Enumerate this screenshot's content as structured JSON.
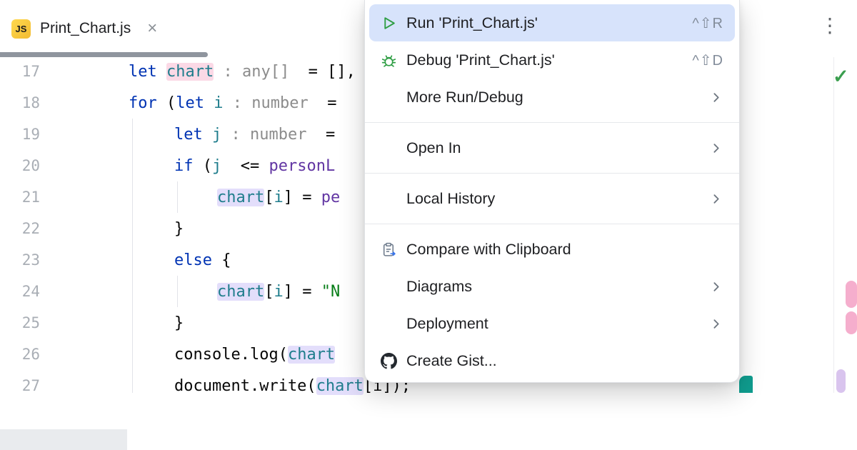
{
  "tab": {
    "file_icon_label": "JS",
    "title": "Print_Chart.js",
    "close_glyph": "×",
    "more_glyph": "⋮"
  },
  "editor": {
    "inspection_check_glyph": "✓",
    "lines": [
      {
        "num": 17,
        "indent": 0,
        "tokens": [
          {
            "t": "let ",
            "c": "kw"
          },
          {
            "t": "chart",
            "c": "var",
            "hl": "pink"
          },
          {
            "t": " ",
            "c": "plain"
          },
          {
            "t": ": any[]",
            "c": "type"
          },
          {
            "t": "  = ",
            "c": "plain"
          },
          {
            "t": "[],",
            "c": "plain"
          }
        ]
      },
      {
        "num": 18,
        "indent": 0,
        "tokens": [
          {
            "t": "for",
            "c": "kw"
          },
          {
            "t": " (",
            "c": "plain"
          },
          {
            "t": "let",
            "c": "kw"
          },
          {
            "t": " ",
            "c": "plain"
          },
          {
            "t": "i",
            "c": "var"
          },
          {
            "t": " ",
            "c": "plain"
          },
          {
            "t": ": number",
            "c": "type"
          },
          {
            "t": "  =",
            "c": "plain"
          }
        ]
      },
      {
        "num": 19,
        "indent": 1,
        "tokens": [
          {
            "t": "let",
            "c": "kw"
          },
          {
            "t": " ",
            "c": "plain"
          },
          {
            "t": "j",
            "c": "var"
          },
          {
            "t": " ",
            "c": "plain"
          },
          {
            "t": ": number",
            "c": "type"
          },
          {
            "t": "  = ",
            "c": "plain"
          }
        ]
      },
      {
        "num": 20,
        "indent": 1,
        "tokens": [
          {
            "t": "if",
            "c": "kw"
          },
          {
            "t": " (",
            "c": "plain"
          },
          {
            "t": "j",
            "c": "var"
          },
          {
            "t": "  <= ",
            "c": "plain"
          },
          {
            "t": "personL",
            "c": "field"
          }
        ]
      },
      {
        "num": 21,
        "indent": 2,
        "tokens": [
          {
            "t": "chart",
            "c": "var",
            "hl": "lav"
          },
          {
            "t": "[",
            "c": "plain"
          },
          {
            "t": "i",
            "c": "var"
          },
          {
            "t": "] = ",
            "c": "plain"
          },
          {
            "t": "pe",
            "c": "field"
          }
        ]
      },
      {
        "num": 22,
        "indent": 1,
        "tokens": [
          {
            "t": "}",
            "c": "plain"
          }
        ]
      },
      {
        "num": 23,
        "indent": 1,
        "tokens": [
          {
            "t": "else",
            "c": "kw"
          },
          {
            "t": " {",
            "c": "plain"
          }
        ]
      },
      {
        "num": 24,
        "indent": 2,
        "tokens": [
          {
            "t": "chart",
            "c": "var",
            "hl": "lav"
          },
          {
            "t": "[",
            "c": "plain"
          },
          {
            "t": "i",
            "c": "var"
          },
          {
            "t": "] = ",
            "c": "plain"
          },
          {
            "t": "\"N",
            "c": "str"
          }
        ]
      },
      {
        "num": 25,
        "indent": 1,
        "tokens": [
          {
            "t": "}",
            "c": "plain"
          }
        ]
      },
      {
        "num": 26,
        "indent": 1,
        "tokens": [
          {
            "t": "console.log(",
            "c": "plain"
          },
          {
            "t": "chart",
            "c": "var",
            "hl": "lav"
          }
        ]
      },
      {
        "num": 27,
        "indent": 1,
        "tokens": [
          {
            "t": "document.write(",
            "c": "plain"
          },
          {
            "t": "chart",
            "c": "var",
            "hl": "lav"
          },
          {
            "t": "[i]);",
            "c": "plain"
          }
        ]
      }
    ]
  },
  "menu": {
    "items": [
      {
        "label": "Run 'Print_Chart.js'",
        "icon": "run",
        "shortcut": "^⇧R",
        "selected": true
      },
      {
        "label": "Debug 'Print_Chart.js'",
        "icon": "debug",
        "shortcut": "^⇧D"
      },
      {
        "label": "More Run/Debug",
        "submenu": true
      },
      {
        "type": "separator"
      },
      {
        "label": "Open In",
        "submenu": true
      },
      {
        "type": "separator"
      },
      {
        "label": "Local History",
        "submenu": true
      },
      {
        "type": "separator"
      },
      {
        "label": "Compare with Clipboard",
        "icon": "clipboard"
      },
      {
        "label": "Diagrams",
        "submenu": true
      },
      {
        "label": "Deployment",
        "submenu": true
      },
      {
        "label": "Create Gist...",
        "icon": "github"
      }
    ]
  },
  "colors": {
    "selection": "#d7e3fb",
    "run_green": "#2f9e44",
    "keyword": "#0033b3",
    "variable": "#1f7d8c",
    "type_annotation": "#8c8c8c",
    "string": "#067d17",
    "field": "#6236a3",
    "highlight_pink": "#fbd9e6",
    "highlight_lavender": "#e3defb"
  }
}
